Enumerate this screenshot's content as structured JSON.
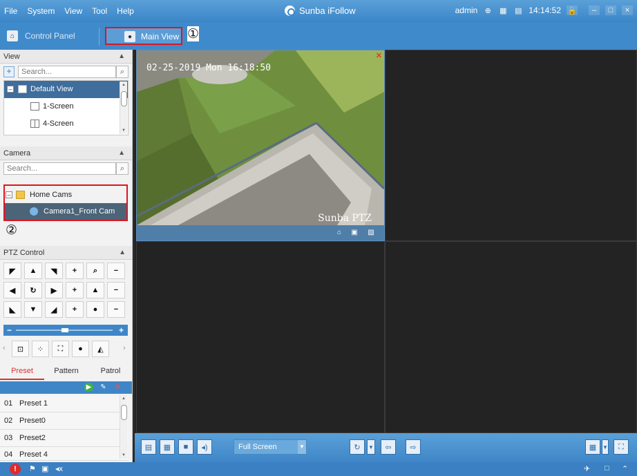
{
  "titlebar": {
    "menu": [
      "File",
      "System",
      "View",
      "Tool",
      "Help"
    ],
    "app_title": "Sunba iFollow",
    "user": "admin",
    "time": "14:14:52"
  },
  "tabs": {
    "control_panel": "Control Panel",
    "main_view": "Main View"
  },
  "markers": {
    "one": "①",
    "two": "②"
  },
  "view_section": {
    "title": "View",
    "search_placeholder": "Search...",
    "tree": {
      "root": "Default View",
      "items": [
        "1-Screen",
        "4-Screen"
      ]
    }
  },
  "camera_section": {
    "title": "Camera",
    "search_placeholder": "Search...",
    "group": "Home Cams",
    "camera": "Camera1_Front Cam"
  },
  "ptz": {
    "title": "PTZ Control",
    "tabs": [
      "Preset",
      "Pattern",
      "Patrol"
    ],
    "active_tab": "Preset",
    "presets": [
      {
        "num": "01",
        "name": "Preset 1"
      },
      {
        "num": "02",
        "name": "Preset0"
      },
      {
        "num": "03",
        "name": "Preset2"
      },
      {
        "num": "04",
        "name": "Preset 4"
      }
    ]
  },
  "video": {
    "osd_time": "02-25-2019 Mon 16:18:50",
    "osd_name": "Sunba PTZ"
  },
  "bottombar": {
    "fullscreen_label": "Full Screen"
  },
  "colors": {
    "accent": "#3f86c8",
    "highlight": "#e0141e",
    "selected": "#3f6d9c"
  }
}
